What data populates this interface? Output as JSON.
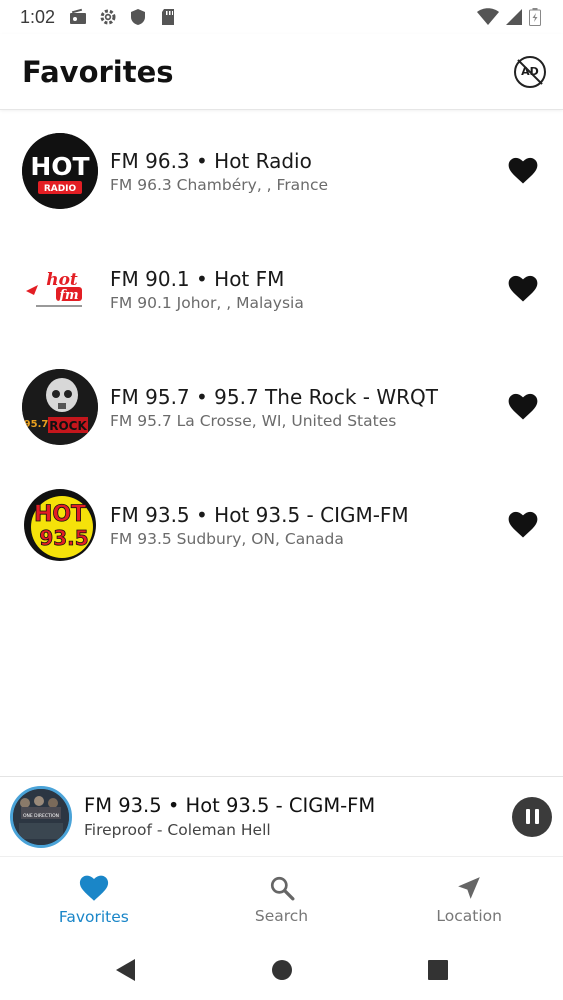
{
  "status_bar": {
    "time": "1:02",
    "icons": [
      "radio-icon",
      "gear-icon",
      "shield-icon",
      "sd-card-icon"
    ],
    "right_icons": [
      "wifi-icon",
      "signal-icon",
      "battery-icon"
    ]
  },
  "header": {
    "title": "Favorites",
    "ad_label": "AD"
  },
  "stations": [
    {
      "title": "FM 96.3 • Hot Radio",
      "subtitle": "FM 96.3 Chambéry, , France",
      "logo_text_top": "HOT",
      "logo_text_bottom": "RADIO"
    },
    {
      "title": "FM 90.1 • Hot FM",
      "subtitle": "FM 90.1 Johor, , Malaysia",
      "logo_text_top": "hot",
      "logo_text_bottom": "fm"
    },
    {
      "title": "FM 95.7 • 95.7 The Rock - WRQT",
      "subtitle": "FM 95.7 La Crosse, WI, United States",
      "logo_text_top": "95.7",
      "logo_text_bottom": "ROCK"
    },
    {
      "title": "FM 93.5 • Hot 93.5 - CIGM-FM",
      "subtitle": "FM 93.5 Sudbury, ON, Canada",
      "logo_text_top": "HOT",
      "logo_text_bottom": "93.5"
    }
  ],
  "player": {
    "title": "FM 93.5 • Hot 93.5 - CIGM-FM",
    "track": "Fireproof -  Coleman Hell",
    "art_text": "ONE DIRECTION"
  },
  "nav": {
    "favorites": "Favorites",
    "search": "Search",
    "location": "Location"
  },
  "colors": {
    "accent": "#1a86c8",
    "inactive": "#777777",
    "heart": "#111111"
  }
}
